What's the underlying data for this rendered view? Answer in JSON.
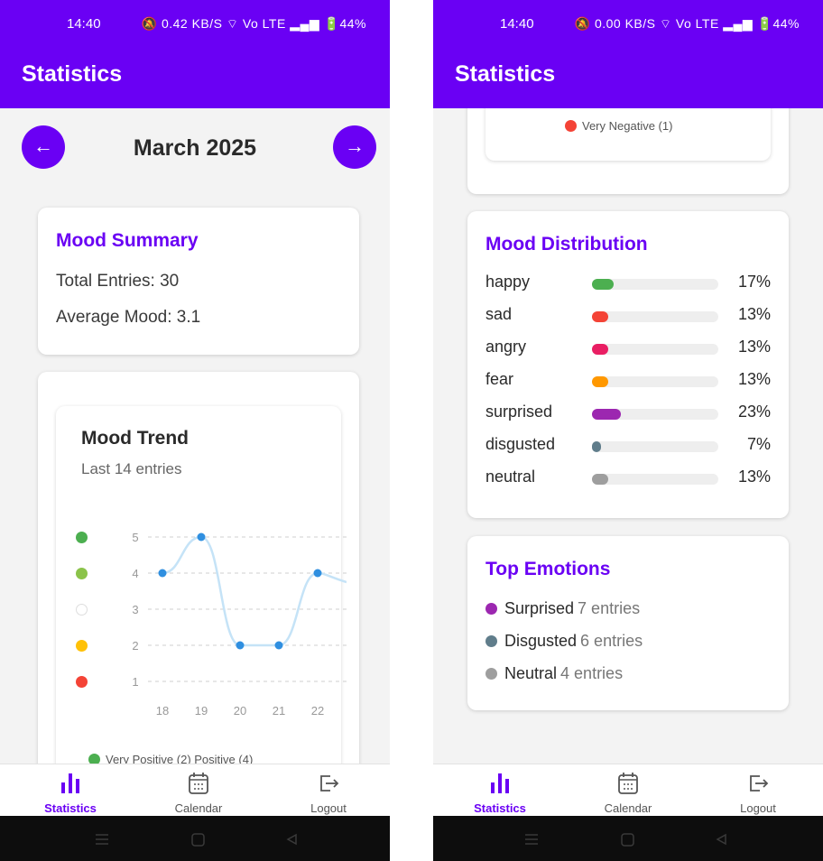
{
  "status_bar": {
    "left": {
      "time": "14:40",
      "icons": "🔕 0.42 KB/S ⌔ Vo LTE ▂▄▆ 🔋44%"
    },
    "right": {
      "time": "14:40",
      "icons": "🔕 0.00 KB/S ⌔ Vo LTE ▂▄▆ 🔋44%"
    }
  },
  "appbar": {
    "title": "Statistics"
  },
  "month_nav": {
    "prev_icon": "arrow-left-icon",
    "prev_glyph": "←",
    "month": "March 2025",
    "next_icon": "arrow-right-icon",
    "next_glyph": "→"
  },
  "mood_summary": {
    "title": "Mood Summary",
    "total_entries": "Total Entries: 30",
    "average_mood": "Average Mood: 3.1"
  },
  "mood_trend": {
    "title": "Mood Trend",
    "subtitle": "Last 14 entries",
    "mood_colors": [
      "#4caf50",
      "#8bc34a",
      "#ffffff",
      "#ffc107",
      "#f44336"
    ],
    "legend_bottom": "Very Positive (2)   Positive (4)",
    "legend_continued": "Very Negative (1)"
  },
  "chart_data": {
    "type": "line",
    "x": [
      "18",
      "19",
      "20",
      "21",
      "22"
    ],
    "y": [
      4,
      5,
      2,
      2,
      4
    ],
    "ylim": [
      1,
      5
    ],
    "yticks": [
      "5",
      "4",
      "3",
      "2",
      "1"
    ],
    "grid": true,
    "point_color": "#2f8fe0",
    "line_color": "#c5e3f7"
  },
  "mood_distribution": {
    "title": "Mood Distribution",
    "rows": [
      {
        "label": "happy",
        "value": 17,
        "pct": "17%",
        "color": "#4caf50"
      },
      {
        "label": "sad",
        "value": 13,
        "pct": "13%",
        "color": "#f44336"
      },
      {
        "label": "angry",
        "value": 13,
        "pct": "13%",
        "color": "#e91e63"
      },
      {
        "label": "fear",
        "value": 13,
        "pct": "13%",
        "color": "#ff9800"
      },
      {
        "label": "surprised",
        "value": 23,
        "pct": "23%",
        "color": "#9c27b0"
      },
      {
        "label": "disgusted",
        "value": 7,
        "pct": "7%",
        "color": "#607d8b"
      },
      {
        "label": "neutral",
        "value": 13,
        "pct": "13%",
        "color": "#9e9e9e"
      }
    ]
  },
  "top_emotions": {
    "title": "Top Emotions",
    "items": [
      {
        "label": "Surprised",
        "count": "7 entries",
        "color": "#9c27b0"
      },
      {
        "label": "Disgusted",
        "count": "6 entries",
        "color": "#607d8b"
      },
      {
        "label": "Neutral",
        "count": "4 entries",
        "color": "#9e9e9e"
      }
    ]
  },
  "bottom_nav": {
    "items": [
      {
        "label": "Statistics",
        "icon": "bar-chart-icon"
      },
      {
        "label": "Calendar",
        "icon": "calendar-icon"
      },
      {
        "label": "Logout",
        "icon": "logout-icon"
      }
    ]
  },
  "system_nav": {
    "icons": [
      "menu-icon",
      "home-icon",
      "back-icon"
    ]
  }
}
